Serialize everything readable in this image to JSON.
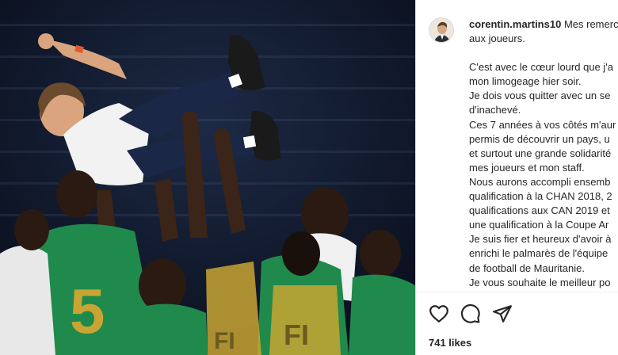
{
  "post": {
    "username": "corentin.martins10",
    "caption_lines": [
      "Mes remerc",
      "aux joueurs.",
      "",
      "C'est avec le cœur lourd que j'a",
      "mon limogeage hier soir.",
      "Je dois vous quitter avec un se",
      "d'inachevé.",
      "Ces 7 années à vos côtés m'aur",
      "permis de découvrir un pays, u",
      "et surtout une grande solidarité",
      "mes joueurs et mon staff.",
      "Nous aurons accompli ensemb",
      "qualification à la CHAN 2018, 2",
      "qualifications aux CAN 2019 et",
      "une qualification à la Coupe Ar",
      "Je suis fier et heureux d'avoir à",
      "enrichi le palmarès de l'équipe",
      "de football de Mauritanie.",
      "Je vous souhaite le meilleur po"
    ],
    "likes_label": "741 likes"
  },
  "photo": {
    "jersey_number": "5",
    "jersey_color": "#1f8a4c",
    "shorts_color": "#c8a533",
    "background_color": "#0d1526"
  },
  "icons": {
    "like": "heart-icon",
    "comment": "comment-icon",
    "share": "paper-plane-icon"
  }
}
